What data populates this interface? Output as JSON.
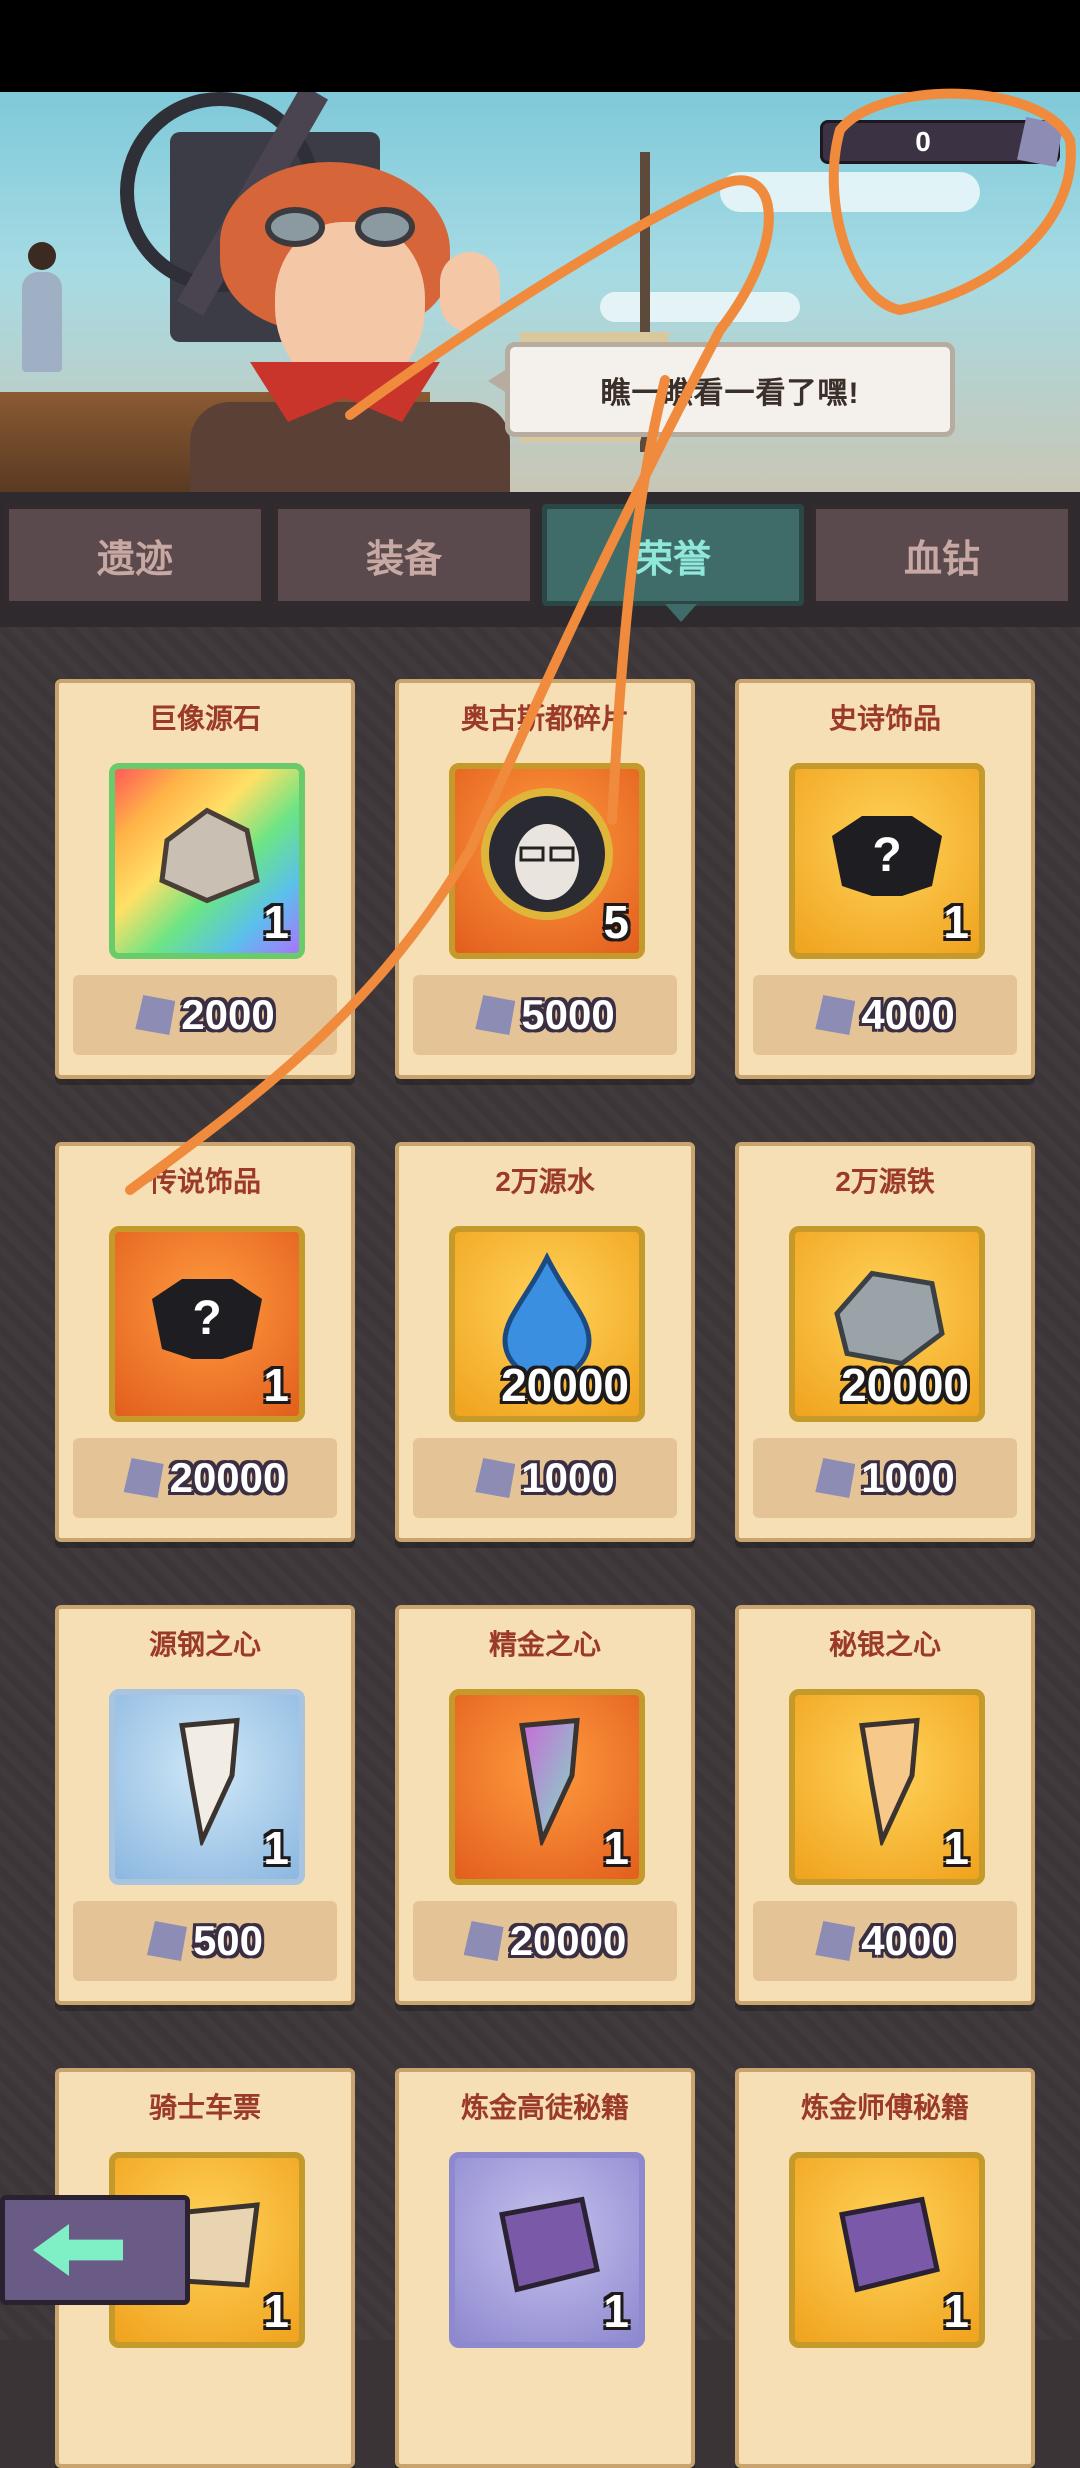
{
  "header": {
    "speech_bubble": "瞧一瞧看一看了嘿!",
    "currency_value": "0",
    "currency_icon": "crystal-gem-icon"
  },
  "tabs": [
    {
      "label": "遗迹",
      "active": false
    },
    {
      "label": "装备",
      "active": false
    },
    {
      "label": "荣誉",
      "active": true
    },
    {
      "label": "血钻",
      "active": false
    }
  ],
  "items": [
    {
      "name": "巨像源石",
      "qty": "1",
      "price": "2000",
      "icon": "stone-icon"
    },
    {
      "name": "奥古斯都碎片",
      "qty": "5",
      "price": "5000",
      "icon": "hero-portrait-icon"
    },
    {
      "name": "史诗饰品",
      "qty": "1",
      "price": "4000",
      "icon": "mystery-accessory-icon"
    },
    {
      "name": "传说饰品",
      "qty": "1",
      "price": "20000",
      "icon": "mystery-accessory-icon"
    },
    {
      "name": "2万源水",
      "qty": "20000",
      "price": "1000",
      "icon": "water-drop-icon"
    },
    {
      "name": "2万源铁",
      "qty": "20000",
      "price": "1000",
      "icon": "iron-ore-icon"
    },
    {
      "name": "源钢之心",
      "qty": "1",
      "price": "500",
      "icon": "fang-icon"
    },
    {
      "name": "精金之心",
      "qty": "1",
      "price": "20000",
      "icon": "fang-icon"
    },
    {
      "name": "秘银之心",
      "qty": "1",
      "price": "4000",
      "icon": "fang-icon"
    },
    {
      "name": "骑士车票",
      "qty": "1",
      "price": "",
      "icon": "ticket-icon"
    },
    {
      "name": "炼金高徒秘籍",
      "qty": "1",
      "price": "",
      "icon": "book-icon"
    },
    {
      "name": "炼金师傅秘籍",
      "qty": "1",
      "price": "",
      "icon": "book-icon"
    }
  ],
  "colors": {
    "accent_tab": "#3f6b69",
    "card_bg": "#f6dfb4",
    "annotation": "#f08a3c"
  }
}
